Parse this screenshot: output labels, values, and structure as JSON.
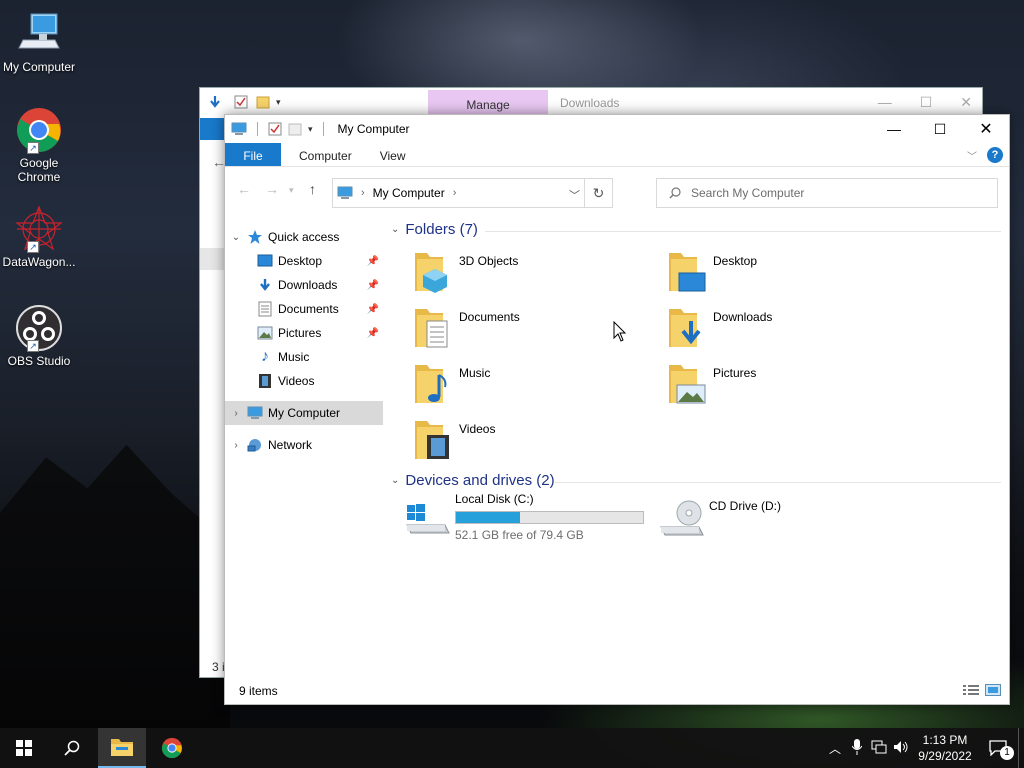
{
  "desktop": {
    "icons": [
      {
        "label": "My Computer",
        "icon": "computer-icon"
      },
      {
        "label": "Google Chrome",
        "icon": "chrome-icon"
      },
      {
        "label": "DataWagon...",
        "icon": "datawagon-icon"
      },
      {
        "label": "OBS Studio",
        "icon": "obs-icon"
      }
    ]
  },
  "back_window": {
    "context_tab": "Manage",
    "title": "Downloads",
    "status_fragment": "3 i"
  },
  "window": {
    "title": "My Computer",
    "ribbon_tabs": [
      "File",
      "Computer",
      "View"
    ],
    "address": {
      "crumb": "My Computer"
    },
    "search": {
      "placeholder": "Search My Computer"
    },
    "nav": {
      "quick_access": "Quick access",
      "pinned": [
        "Desktop",
        "Downloads",
        "Documents",
        "Pictures"
      ],
      "unpinned": [
        "Music",
        "Videos"
      ],
      "my_computer": "My Computer",
      "network": "Network"
    },
    "folders_group": "Folders (7)",
    "folders": [
      "3D Objects",
      "Desktop",
      "Documents",
      "Downloads",
      "Music",
      "Pictures",
      "Videos"
    ],
    "drives_group": "Devices and drives (2)",
    "drives": [
      {
        "name": "Local Disk (C:)",
        "free_text": "52.1 GB free of 79.4 GB",
        "used_fraction": 0.344
      },
      {
        "name": "CD Drive (D:)"
      }
    ],
    "status": "9 items"
  },
  "taskbar": {
    "time": "1:13 PM",
    "date": "9/29/2022",
    "notification_count": "1"
  },
  "colors": {
    "accent": "#1979ca",
    "drive_fill": "#26a0da",
    "folder": "#f6d26a",
    "manage_tab": "#e8c7f2"
  }
}
